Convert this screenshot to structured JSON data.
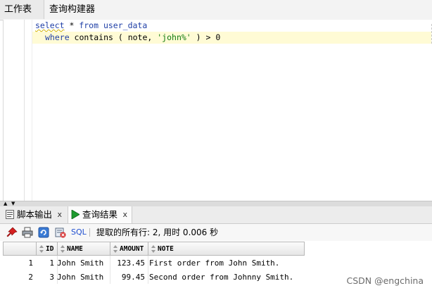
{
  "top_tabs": [
    "工作表",
    "查询构建器"
  ],
  "editor": {
    "line1": {
      "kw1": "select",
      "mid": " * ",
      "kw2": "from",
      "rest": " user_data"
    },
    "line2": {
      "kw": "where",
      "p1": " contains ( note, ",
      "str": "'john%'",
      "p2": " ) > 0"
    }
  },
  "bottom_tabs": {
    "script_output": {
      "label": "脚本输出",
      "close": "x"
    },
    "query_result": {
      "label": "查询结果",
      "close": "x"
    }
  },
  "toolbar": {
    "sql_label": "SQL",
    "separator": "|",
    "status": "提取的所有行: 2, 用时 0.006 秒",
    "icons": [
      "pin-icon",
      "print-icon",
      "refresh-icon",
      "delete-icon"
    ]
  },
  "grid": {
    "columns": [
      "ID",
      "NAME",
      "AMOUNT",
      "NOTE"
    ],
    "rows": [
      {
        "rownum": "1",
        "id": "1",
        "name": "John Smith",
        "amount": "123.45",
        "note": "First order from John Smith."
      },
      {
        "rownum": "2",
        "id": "3",
        "name": "John Smith",
        "amount": "99.45",
        "note": "Second order from Johnny Smith."
      }
    ]
  },
  "watermark": "CSDN @engchina",
  "colors": {
    "keyword": "#1f3fa6",
    "string": "#0e7a0e",
    "current_line": "#fffbd5",
    "sql_link": "#1f4fd0"
  }
}
